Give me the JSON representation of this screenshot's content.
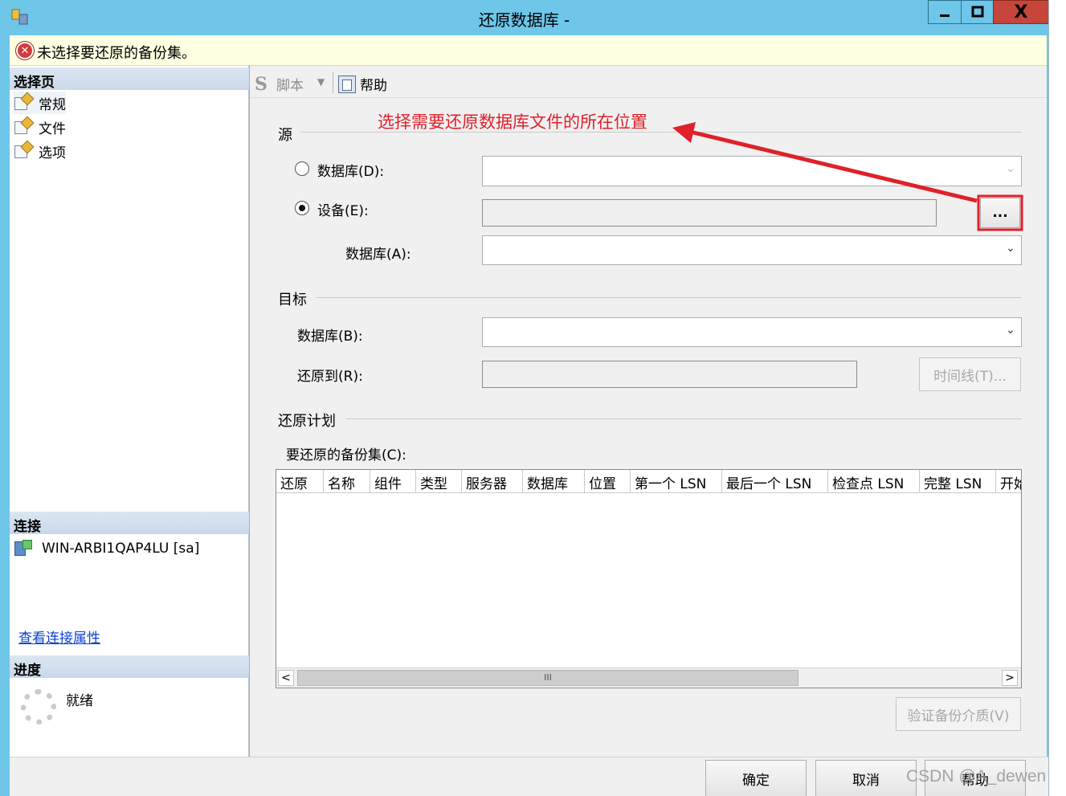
{
  "window": {
    "title": "还原数据库 -",
    "controls": {
      "minimize": "▁",
      "maximize": "□",
      "close": "X"
    }
  },
  "error_bar": {
    "icon": "error-icon",
    "message": "未选择要还原的备份集。"
  },
  "left_pane": {
    "select_page": {
      "header": "选择页",
      "items": [
        {
          "label": "常规",
          "icon": "page-icon",
          "selected": true
        },
        {
          "label": "文件",
          "icon": "page-icon"
        },
        {
          "label": "选项",
          "icon": "page-icon"
        }
      ]
    },
    "connection": {
      "header": "连接",
      "server": "WIN-ARBI1QAP4LU [sa]",
      "link": "查看连接属性"
    },
    "progress": {
      "header": "进度",
      "status": "就绪"
    }
  },
  "toolbar": {
    "script_label": "脚本",
    "help_label": "帮助"
  },
  "annotation": {
    "text": "选择需要还原数据库文件的所在位置",
    "color": "#e0202a"
  },
  "source": {
    "label": "源",
    "database_radio": "数据库(D):",
    "device_radio": "设备(E):",
    "selected_radio": "device",
    "device_browse": "...",
    "database_a_label": "数据库(A):"
  },
  "target": {
    "label": "目标",
    "database_b_label": "数据库(B):",
    "restore_to_label": "还原到(R):",
    "timeline_button": "时间线(T)..."
  },
  "plan": {
    "label": "还原计划",
    "backup_sets_label": "要还原的备份集(C):",
    "columns": [
      "还原",
      "名称",
      "组件",
      "类型",
      "服务器",
      "数据库",
      "位置",
      "第一个 LSN",
      "最后一个 LSN",
      "检查点 LSN",
      "完整 LSN",
      "开始"
    ],
    "rows": [],
    "scroll_thumb": "III",
    "verify_button": "验证备份介质(V)"
  },
  "footer": {
    "ok": "确定",
    "cancel": "取消",
    "help": "帮助"
  },
  "watermark": "CSDN @A_dewen"
}
